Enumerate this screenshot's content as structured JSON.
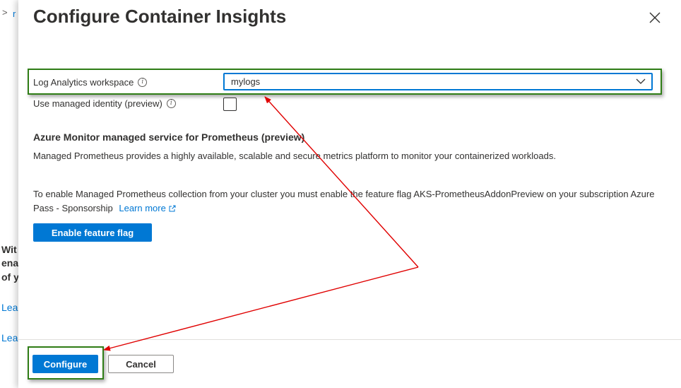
{
  "background": {
    "breadcrumb": "r",
    "text_lines": [
      "Wit",
      "ena",
      "of y"
    ],
    "links": [
      "Lea",
      "Lea"
    ]
  },
  "panel": {
    "title": "Configure Container Insights",
    "workspace_label": "Log Analytics workspace",
    "workspace_value": "mylogs",
    "managed_identity_label": "Use managed identity (preview)",
    "managed_identity_checked": false,
    "prometheus_heading": "Azure Monitor managed service for Prometheus (preview)",
    "prometheus_description": "Managed Prometheus provides a highly available, scalable and secure metrics platform to monitor your containerized workloads.",
    "feature_flag_text": "To enable Managed Prometheus collection from your cluster you must enable the feature flag AKS-PrometheusAddonPreview on your subscription Azure Pass - Sponsorship",
    "learn_more": "Learn more",
    "enable_flag_button": "Enable feature flag",
    "configure_button": "Configure",
    "cancel_button": "Cancel"
  },
  "colors": {
    "accent": "#0078d4",
    "annotation_box": "#2f7d16",
    "annotation_arrow": "#e00000"
  }
}
